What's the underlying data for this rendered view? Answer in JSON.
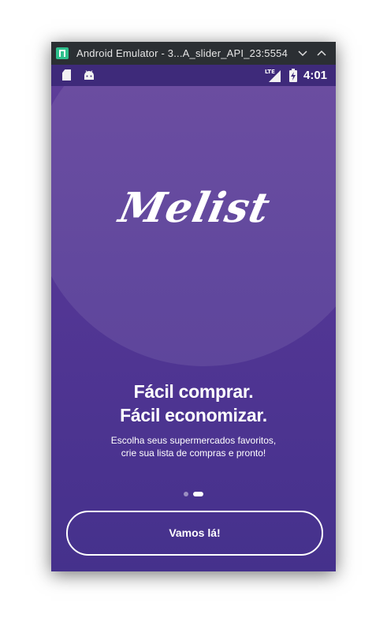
{
  "window": {
    "title": "Android Emulator - 3...A_slider_API_23:5554",
    "minimize_icon": "chevron-down",
    "maximize_icon": "chevron-up"
  },
  "status_bar": {
    "icons": [
      "sd-card-icon",
      "android-icon",
      "lte-signal-icon",
      "battery-charging-icon"
    ],
    "network": "LTE",
    "time": "4:01"
  },
  "slide": {
    "logo_text": "Melist",
    "headline_1": "Fácil comprar.",
    "headline_2": "Fácil economizar.",
    "subtitle_1": "Escolha seus supermercados favoritos,",
    "subtitle_2": "crie sua lista de compras e pronto!",
    "page_count": 2,
    "active_page": 2
  },
  "cta": {
    "label": "Vamos lá!"
  },
  "colors": {
    "background": "#523694",
    "circle": "rgba(255,255,255,0.085)",
    "text": "#ffffff",
    "titlebar": "#2b2f33"
  }
}
